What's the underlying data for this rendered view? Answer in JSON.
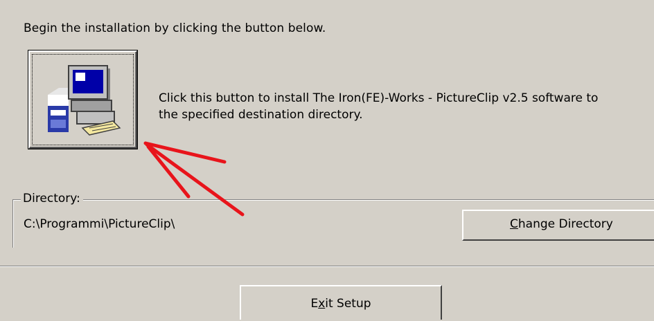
{
  "intro": {
    "text": "Begin the installation by clicking the button below."
  },
  "install": {
    "description_line1": "Click this button to install The Iron(FE)-Works - PictureClip v2.5 software to",
    "description_line2": "the specified destination directory.",
    "icon": "setup-computer-icon"
  },
  "directory": {
    "label": "Directory:",
    "path": "C:\\Programmi\\PictureClip\\",
    "change_button": {
      "mnemonic": "C",
      "rest": "hange Directory"
    }
  },
  "exit_button": {
    "before": "E",
    "mnemonic": "x",
    "after": "it Setup"
  },
  "annotation": {
    "arrow_color": "#e8141b"
  },
  "colors": {
    "background": "#d4d0c8"
  }
}
